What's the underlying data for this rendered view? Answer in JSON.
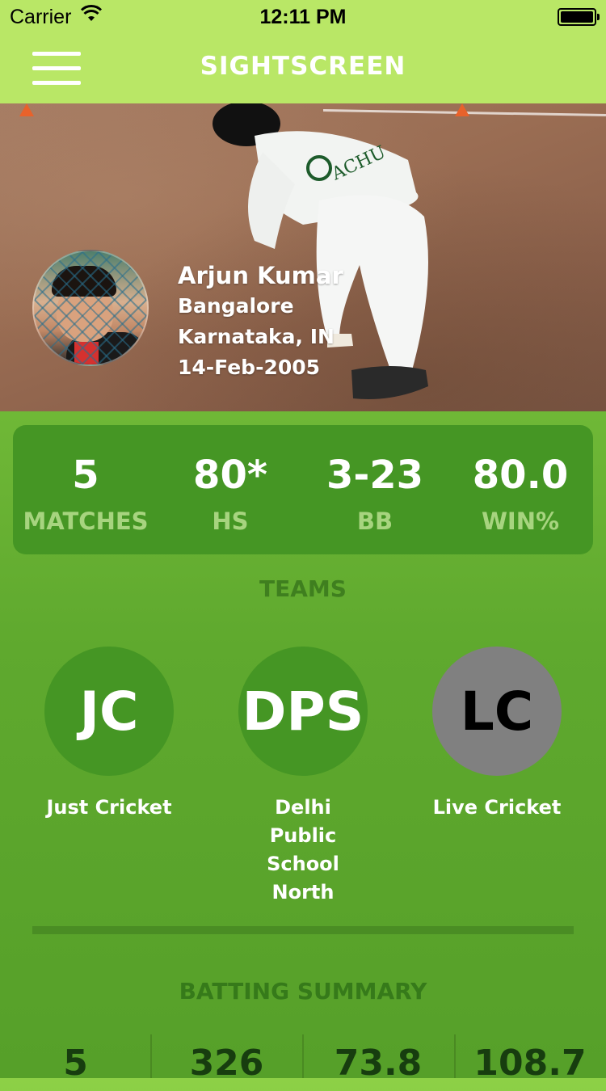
{
  "status_bar": {
    "carrier": "Carrier",
    "time": "12:11 PM"
  },
  "nav": {
    "title": "SIGHTSCREEN"
  },
  "profile": {
    "name": "Arjun Kumar",
    "city": "Bangalore",
    "region": "Karnataka, IN",
    "dob": "14-Feb-2005"
  },
  "stats": [
    {
      "value": "5",
      "label": "MATCHES"
    },
    {
      "value": "80*",
      "label": "HS"
    },
    {
      "value": "3-23",
      "label": "BB"
    },
    {
      "value": "80.0",
      "label": "WIN%"
    }
  ],
  "teams_title": "TEAMS",
  "teams": [
    {
      "initials": "JC",
      "name": "Just Cricket",
      "color": "#459624",
      "text_color": "#ffffff"
    },
    {
      "initials": "DPS",
      "name": "Delhi Public School North",
      "color": "#459624",
      "text_color": "#ffffff"
    },
    {
      "initials": "LC",
      "name": "Live Cricket",
      "color": "#808080",
      "text_color": "#000000"
    }
  ],
  "batting_title": "BATTING SUMMARY",
  "batting": [
    "5",
    "326",
    "73.8",
    "108.7"
  ],
  "colors": {
    "nav_bg": "#b9e766",
    "stats_card": "#459624",
    "stat_label": "#a7d47f",
    "section_title": "#3f7f1f"
  }
}
